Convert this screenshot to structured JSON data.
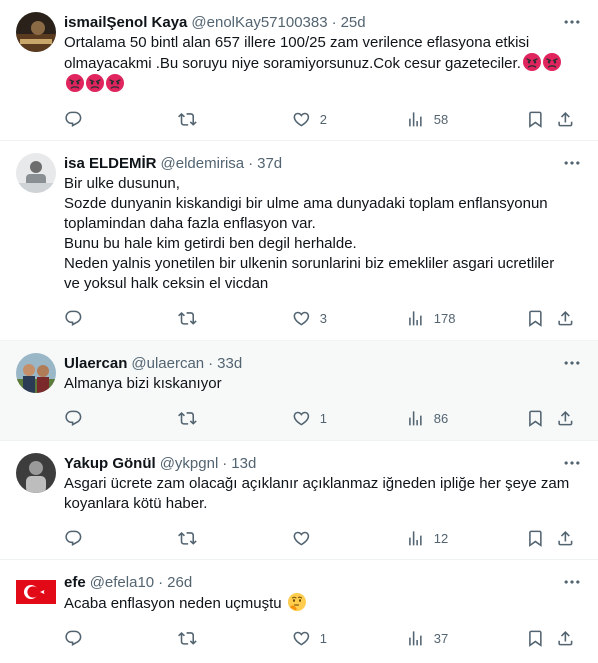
{
  "colors": {
    "text": "#0f1419",
    "secondary": "#536471",
    "divider": "#eff3f4",
    "highlight": "#f7f9f9",
    "angry_emoji": "#e0245e"
  },
  "tweets": [
    {
      "name": "ismailŞenol Kaya",
      "handle": "@enolKay57100383",
      "sep": "·",
      "time": "25d",
      "text": "Ortalama 50 bintl alan 657 illere 100/25 zam verilence eflasyona etkisi olmayacakmi .Bu soruyu niye soramiyorsunuz.Cok cesur gazeteciler.",
      "emoji": "angry-face-emoji",
      "reply_count": "",
      "retweet_count": "",
      "like_count": "2",
      "view_count": "58"
    },
    {
      "name": "isa ELDEMİR",
      "handle": "@eldemirisa",
      "sep": "·",
      "time": "37d",
      "text": "Bir ulke dusunun,\nSozde dunyanin kiskandigi bir ulme ama dunyadaki toplam enflansyonun toplamindan daha fazla enflasyon var.\nBunu bu hale kim getirdi ben degil herhalde.\nNeden yalnis yonetilen bir ulkenin sorunlarini biz emekliler asgari ucretliler ve yoksul halk ceksin el vicdan",
      "reply_count": "",
      "retweet_count": "",
      "like_count": "3",
      "view_count": "178"
    },
    {
      "name": "Ulaercan",
      "handle": "@ulaercan",
      "sep": "·",
      "time": "33d",
      "text": "Almanya bizi kıskanıyor",
      "reply_count": "",
      "retweet_count": "",
      "like_count": "1",
      "view_count": "86"
    },
    {
      "name": "Yakup Gönül",
      "handle": "@ykpgnl",
      "sep": "·",
      "time": "13d",
      "text": "Asgari ücrete zam olacağı açıklanır açıklanmaz iğneden ipliğe her şeye zam koyanlara kötü haber.",
      "reply_count": "",
      "retweet_count": "",
      "like_count": "",
      "view_count": "12"
    },
    {
      "name": "efe",
      "handle": "@efela10",
      "sep": "·",
      "time": "26d",
      "text": "Acaba enflasyon neden uçmuştu",
      "emoji": "thinking-face-emoji",
      "reply_count": "",
      "retweet_count": "",
      "like_count": "1",
      "view_count": "37"
    }
  ]
}
